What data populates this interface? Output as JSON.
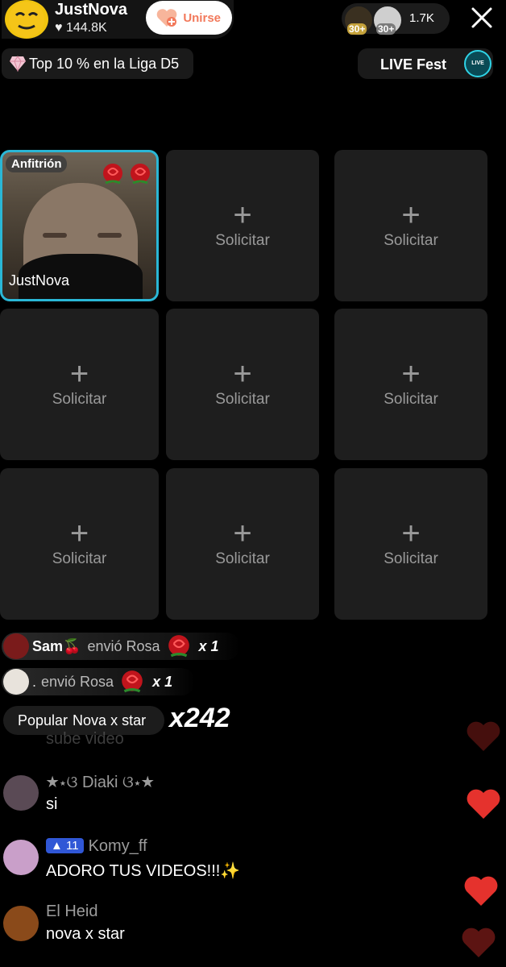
{
  "header": {
    "host_name": "JustNova",
    "likes": "144.8K",
    "join_label": "Unirse",
    "viewers": {
      "count": "1.7K",
      "ranks": [
        "30+",
        "30+"
      ]
    },
    "league_text": "Top 10 % en la Liga D5",
    "fest_label": "LIVE Fest",
    "fest_icon_text": "LIVE"
  },
  "grid": {
    "host_slot": {
      "role": "Anfitrión",
      "name": "JustNova"
    },
    "request_label": "Solicitar",
    "request_symbol": "+"
  },
  "gifts": [
    {
      "user": "Sam🍒",
      "action": "envió Rosa",
      "multiplier": "x 1"
    },
    {
      "user": ".",
      "action": "envió Rosa",
      "multiplier": "x 1"
    }
  ],
  "popular": {
    "label": "Popular",
    "name": "Nova x star",
    "count": "x242"
  },
  "chat": [
    {
      "name": "",
      "message": "sube video"
    },
    {
      "name": "★⋆ଓ Diaki ଓ⋆★",
      "message": "si"
    },
    {
      "name": "Komy_ff",
      "badge": "11",
      "message": "ADORO TUS VIDEOS!!!✨"
    },
    {
      "name": "El Heid",
      "message": "nova x star"
    }
  ],
  "colors": {
    "accent_cyan": "#2ab7d6",
    "join_text": "#f2795b",
    "heart_red": "#e5322d",
    "badge_blue": "#3057d6"
  }
}
